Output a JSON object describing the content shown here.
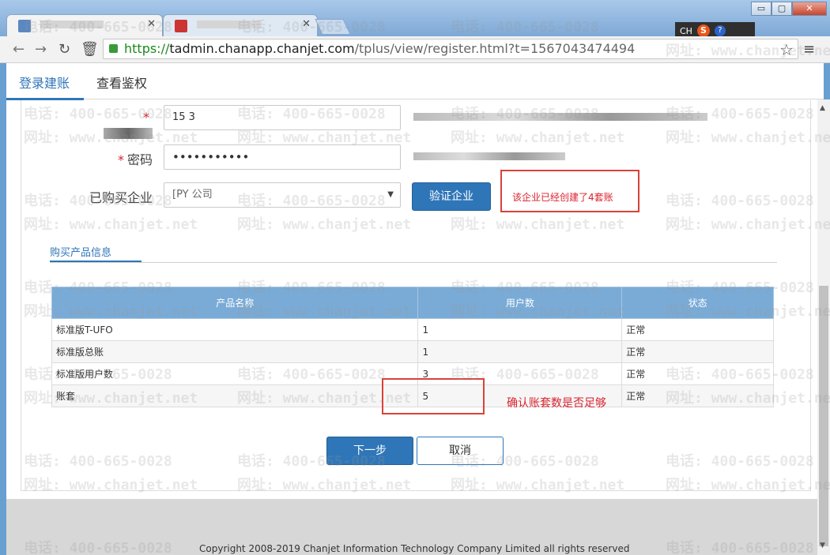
{
  "window": {
    "tabs": [
      {
        "label": ""
      },
      {
        "label": ""
      }
    ],
    "controls": {
      "minimize": "▭",
      "maximize": "▢",
      "close": "✕"
    }
  },
  "ime": {
    "lang": "CH",
    "logo": "S",
    "help": "?"
  },
  "toolbar": {
    "url_scheme": "https://",
    "url_host": "tadmin.chanapp.chanjet.com",
    "url_path": "/tplus/view/register.html?t=1567043474494"
  },
  "subnav": {
    "tab1": "登录建账",
    "tab2": "查看鉴权"
  },
  "form": {
    "account_label": "",
    "account_value": "15          3",
    "password_label": "密码",
    "password_value": "•••••••••••",
    "company_label": "已购买企业",
    "company_value": "[PY                                    公司",
    "verify_button": "验证企业",
    "notice": "该企业已经创建了4套账"
  },
  "product_section": {
    "title": "购买产品信息",
    "columns": [
      "产品名称",
      "用户数",
      "状态"
    ],
    "rows": [
      [
        "标准版T-UFO",
        "1",
        "正常"
      ],
      [
        "标准版总账",
        "1",
        "正常"
      ],
      [
        "标准版用户数",
        "3",
        "正常"
      ],
      [
        "账套",
        "5",
        "正常"
      ]
    ],
    "annotation": "确认账套数是否足够"
  },
  "actions": {
    "next": "下一步",
    "cancel": "取消"
  },
  "footer": {
    "copyright": "Copyright 2008-2019 Chanjet Information Technology Company Limited all rights reserved"
  },
  "watermark": {
    "phone": "电话: 400-665-0028",
    "site": "网址: www.chanjet.net"
  },
  "colors": {
    "accent": "#2f76b8",
    "table_header": "#7aabd7",
    "alert": "#d9232e"
  }
}
